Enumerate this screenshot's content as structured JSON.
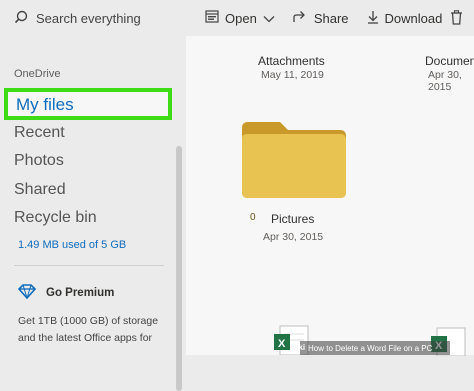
{
  "search": {
    "placeholder": "Search everything"
  },
  "toolbar": {
    "open_label": "Open",
    "share_label": "Share",
    "download_label": "Download"
  },
  "sidebar": {
    "section_label": "OneDrive",
    "items": [
      {
        "label": "My files",
        "selected": true
      },
      {
        "label": "Recent"
      },
      {
        "label": "Photos"
      },
      {
        "label": "Shared"
      },
      {
        "label": "Recycle bin"
      }
    ],
    "storage_text": "1.49 MB used of 5 GB",
    "premium": {
      "title": "Go Premium",
      "description": "Get 1TB (1000 GB) of storage and the latest Office apps for"
    }
  },
  "files": [
    {
      "name": "Attachments",
      "date": "May 11, 2019"
    },
    {
      "name": "Documen",
      "date": "Apr 30, 2015"
    },
    {
      "name": "Pictures",
      "date": "Apr 30, 2015",
      "count": "0"
    }
  ],
  "watermark": {
    "text": "How to Delete a Word File on a PC",
    "brand": "wiki"
  },
  "colors": {
    "accent": "#0f6cbd",
    "highlight": "#3ddc16",
    "folder": "#e8c351",
    "excel": "#217346"
  }
}
